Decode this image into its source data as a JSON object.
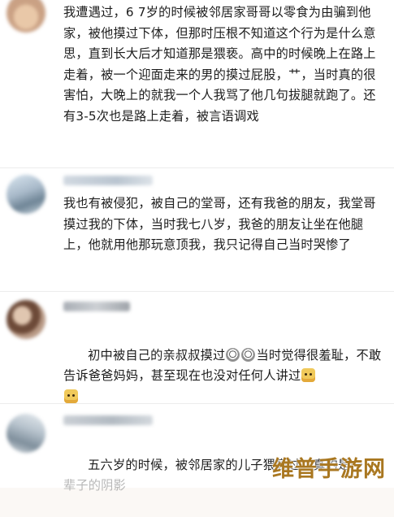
{
  "comments": [
    {
      "text": "我遭遇过，6 7岁的时候被邻居家哥哥以零食为由骗到他家，被他摸过下体，但那时压根不知道这个行为是什么意思，直到长大后才知道那是猥亵。高中的时候晚上在路上走着，被一个迎面走来的男的摸过屁股，艹，当时真的很害怕，大晚上的就我一个人我骂了他几句拔腿就跑了。还有3-5次也是路上走着，被言语调戏"
    },
    {
      "text": "我也有被侵犯，被自己的堂哥，还有我爸的朋友，我堂哥摸过我的下体，当时我七八岁，我爸的朋友让坐在他腿上，他就用他那玩意顶我，我只记得自己当时哭惨了"
    },
    {
      "text_before_emoji": "初中被自己的亲叔叔摸过",
      "text_middle": "当时觉得很羞耻，不敢告诉爸爸妈妈，甚至现在也没对任何人讲过",
      "emoji_1": "crying-face-emoji",
      "emoji_2": "crying-face-emoji",
      "emoji_3": "doge-emoji",
      "emoji_4": "doge-emoji"
    },
    {
      "text": "五六岁的时候，被邻居家的儿子猥亵过，真的是一",
      "text_faded": "辈子的阴影"
    }
  ],
  "watermark": "维普手游网",
  "colors": {
    "background": "#ffffff",
    "text": "#1c1c1c",
    "faded_text": "#b7b7b7",
    "watermark": "#a97720"
  }
}
